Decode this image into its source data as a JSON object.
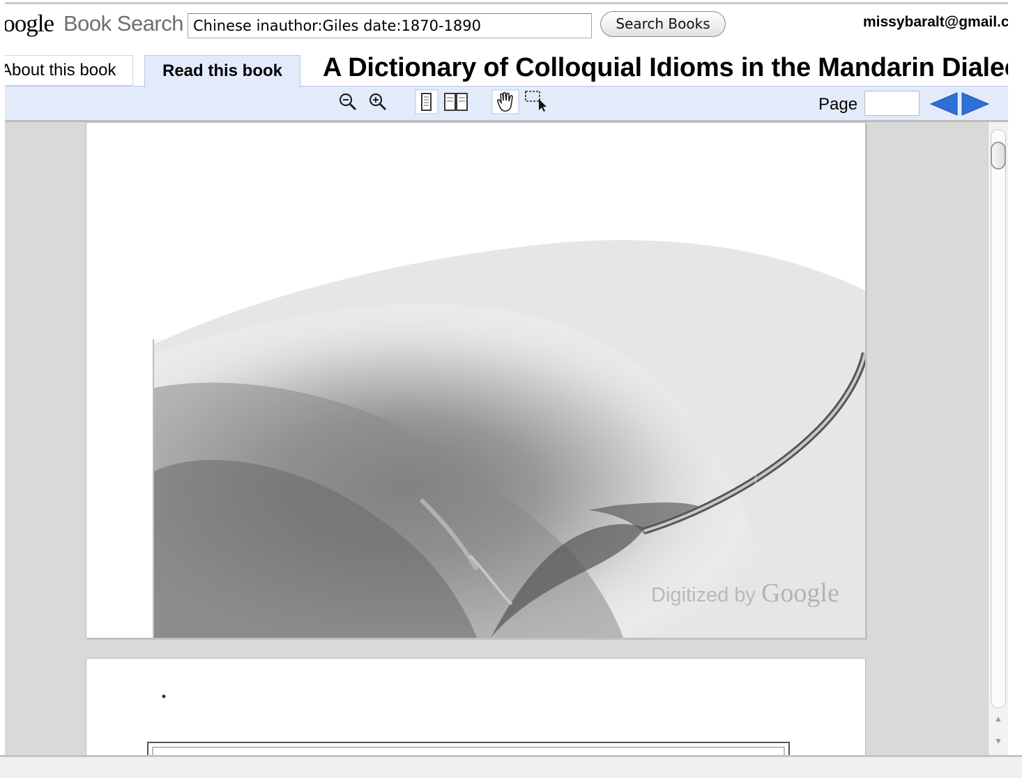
{
  "header": {
    "logo_text_visible": "oogle",
    "product": "Book Search",
    "search_value": "Chinese inauthor:Giles date:1870-1890",
    "search_button": "Search Books",
    "user_email": "missybaralt@gmail.com"
  },
  "tabs": {
    "about": "About this book",
    "read": "Read this book"
  },
  "book": {
    "title": "A Dictionary of Colloquial Idioms in the Mandarin Dialect"
  },
  "toolbar": {
    "zoom_out_icon": "zoom-out-icon",
    "zoom_in_icon": "zoom-in-icon",
    "single_page_icon": "single-page-icon",
    "two_page_icon": "two-page-icon",
    "hand_tool_icon": "hand-tool-icon",
    "select_tool_icon": "select-tool-icon",
    "page_label": "Page",
    "page_value": "",
    "prev_icon": "prev-page-icon",
    "next_icon": "next-page-icon",
    "accent_color": "#2f6fd6"
  },
  "viewer": {
    "watermark_prefix": "Digitized by",
    "watermark_brand": "Google"
  }
}
